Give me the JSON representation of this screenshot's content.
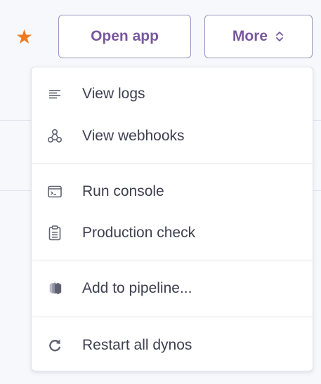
{
  "header": {
    "favorite_icon": "star-icon",
    "open_app_label": "Open app",
    "more_label": "More"
  },
  "menu": {
    "items": [
      {
        "label": "View logs",
        "icon": "logs-icon"
      },
      {
        "label": "View webhooks",
        "icon": "webhooks-icon"
      },
      {
        "label": "Run console",
        "icon": "console-icon"
      },
      {
        "label": "Production check",
        "icon": "clipboard-icon"
      },
      {
        "label": "Add to pipeline...",
        "icon": "pipeline-icon"
      },
      {
        "label": "Restart all dynos",
        "icon": "restart-icon"
      }
    ]
  },
  "colors": {
    "brand_purple": "#79589f",
    "star_orange": "#ee7a21",
    "icon_gray": "#5f6170",
    "text": "#3f3f52"
  }
}
